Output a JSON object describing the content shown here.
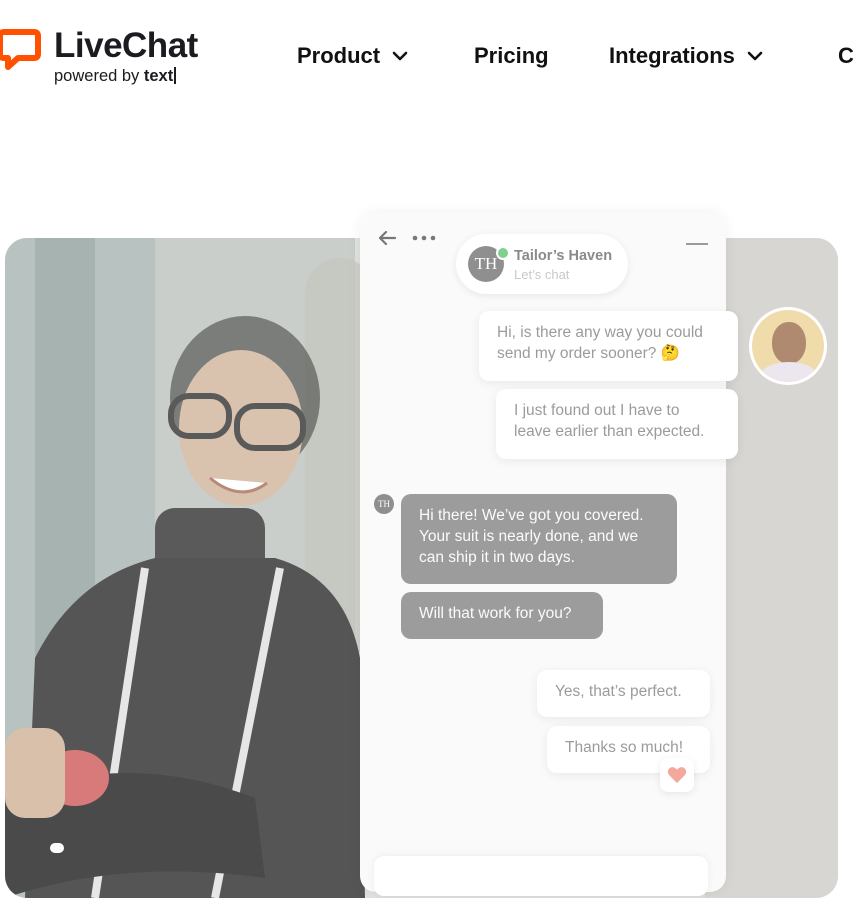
{
  "logo": {
    "name": "LiveChat",
    "tagline_prefix": "powered by ",
    "tagline_brand": "text",
    "accent": "#ff5100"
  },
  "nav": {
    "items": [
      {
        "label": "Product",
        "dropdown": true
      },
      {
        "label": "Pricing",
        "dropdown": false
      },
      {
        "label": "Integrations",
        "dropdown": true
      },
      {
        "label": "C",
        "dropdown": false
      }
    ]
  },
  "chat": {
    "business_name": "Tailor’s Haven",
    "business_status": "Let’s chat",
    "business_initials": "TH",
    "messages": [
      {
        "from": "customer",
        "text": "Hi, is there any way you could send my order sooner? 🤔"
      },
      {
        "from": "customer",
        "text": "I just found out I have to leave earlier than expected."
      },
      {
        "from": "agent",
        "text": "Hi there! We’ve got you covered. Your suit is nearly done, and we can ship it in two days."
      },
      {
        "from": "agent",
        "text": "Will that work for you?"
      },
      {
        "from": "customer",
        "text": "Yes, that’s perfect."
      },
      {
        "from": "customer",
        "text": "Thanks so much!"
      }
    ],
    "reaction": "heart"
  }
}
